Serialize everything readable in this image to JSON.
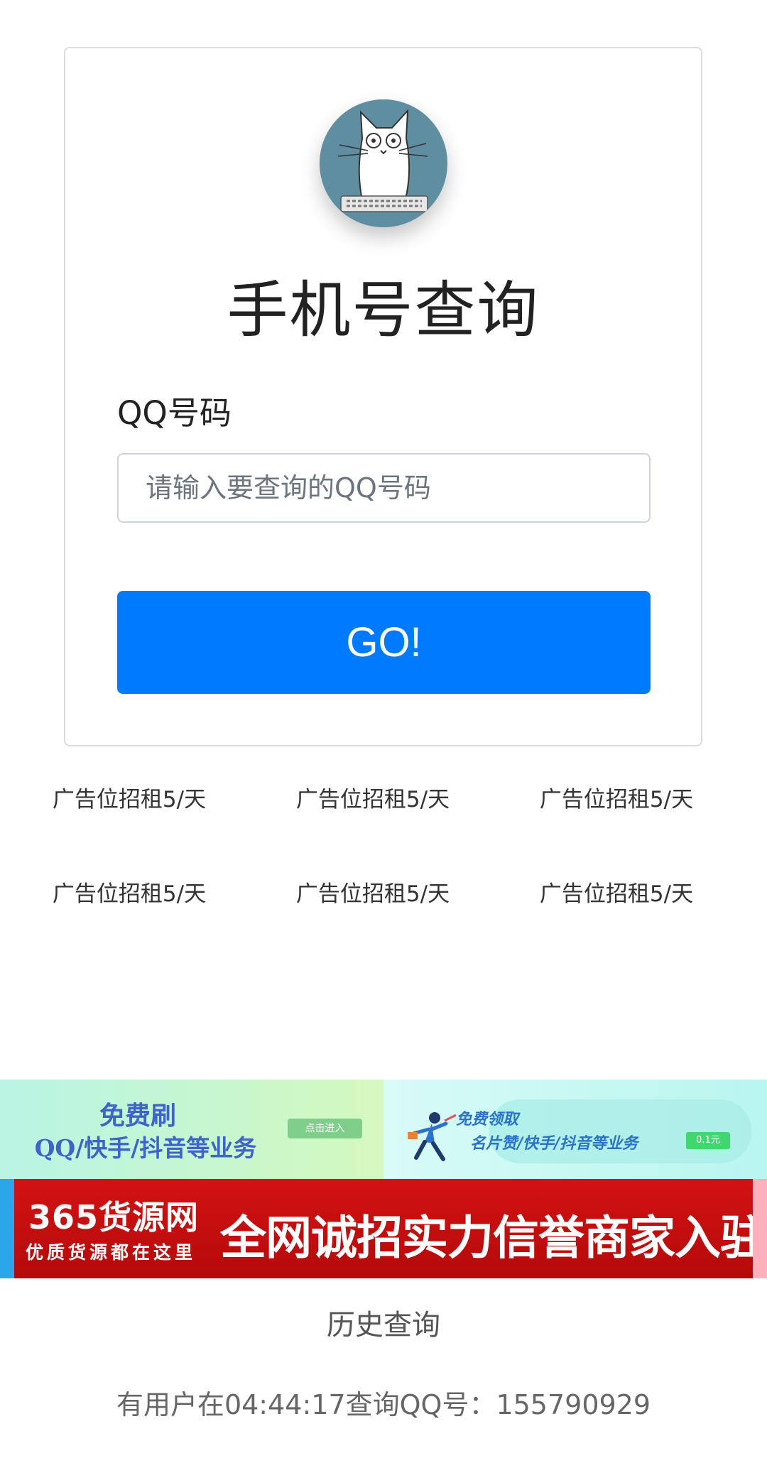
{
  "header": {
    "avatar_icon": "cat-keyboard-icon",
    "title": "手机号查询"
  },
  "form": {
    "label": "QQ号码",
    "input_value": "",
    "input_placeholder": "请输入要查询的QQ号码",
    "submit_label": "GO!"
  },
  "ads": {
    "slots": [
      "广告位招租5/天",
      "广告位招租5/天",
      "广告位招租5/天",
      "广告位招租5/天",
      "广告位招租5/天",
      "广告位招租5/天"
    ]
  },
  "banners": {
    "left": {
      "line1": "免费刷",
      "line2": "QQ/快手/抖音等业务",
      "button": "点击进入"
    },
    "right": {
      "line1": "免费领取",
      "line2": "名片赞/快手/抖音等业务",
      "tag": "0.1元"
    },
    "red": {
      "brand": "365货源网",
      "sub": "优质货源都在这里",
      "slogan": "全网诚招实力信誉商家入驻"
    }
  },
  "history": {
    "title": "历史查询",
    "entry": "有用户在04:44:17查询QQ号：155790929"
  },
  "colors": {
    "primary": "#007bff",
    "avatar_bg": "#5f8ea1",
    "banner_red": "#c40f0f"
  }
}
